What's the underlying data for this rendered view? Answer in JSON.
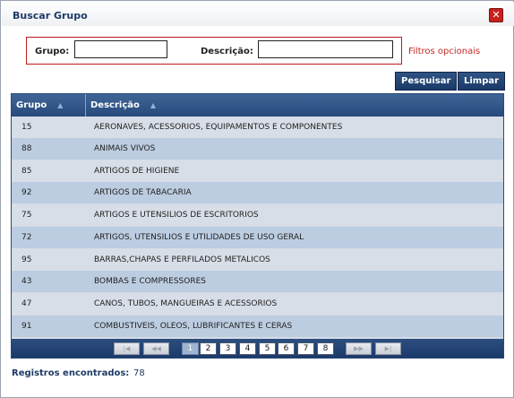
{
  "dialog": {
    "title": "Buscar Grupo",
    "close_glyph": "✕"
  },
  "filters": {
    "grupo_label": "Grupo:",
    "grupo_value": "",
    "descricao_label": "Descrição:",
    "descricao_value": "",
    "optional_note": "Filtros opcionais"
  },
  "actions": {
    "search_label": "Pesquisar",
    "clear_label": "Limpar"
  },
  "table": {
    "columns": [
      {
        "label": "Grupo",
        "sort_icon": "sort-icon"
      },
      {
        "label": "Descrição",
        "sort_icon": "sort-icon"
      }
    ],
    "rows": [
      {
        "code": "15",
        "description": "AERONAVES, ACESSORIOS, EQUIPAMENTOS E COMPONENTES"
      },
      {
        "code": "88",
        "description": "ANIMAIS VIVOS"
      },
      {
        "code": "85",
        "description": "ARTIGOS DE HIGIENE"
      },
      {
        "code": "92",
        "description": "ARTIGOS DE TABACARIA"
      },
      {
        "code": "75",
        "description": "ARTIGOS E UTENSILIOS DE ESCRITORIOS"
      },
      {
        "code": "72",
        "description": "ARTIGOS, UTENSILIOS E UTILIDADES DE USO GERAL"
      },
      {
        "code": "95",
        "description": "BARRAS,CHAPAS E PERFILADOS METALICOS"
      },
      {
        "code": "43",
        "description": "BOMBAS E COMPRESSORES"
      },
      {
        "code": "47",
        "description": "CANOS, TUBOS, MANGUEIRAS E ACESSORIOS"
      },
      {
        "code": "91",
        "description": "COMBUSTIVEIS, OLEOS, LUBRIFICANTES E CERAS"
      }
    ]
  },
  "pager": {
    "first_glyph": "|◀",
    "prev_glyph": "◀◀",
    "next_glyph": "▶▶",
    "last_glyph": "▶|",
    "pages": [
      "1",
      "2",
      "3",
      "4",
      "5",
      "6",
      "7",
      "8"
    ],
    "current_page": "1"
  },
  "footer": {
    "count_label": "Registros encontrados:",
    "count_value": "78"
  },
  "colors": {
    "accent": "#274a7b",
    "row_light": "#d8dee7",
    "row_dark": "#bccde1",
    "filter_border": "#c01b1b"
  }
}
